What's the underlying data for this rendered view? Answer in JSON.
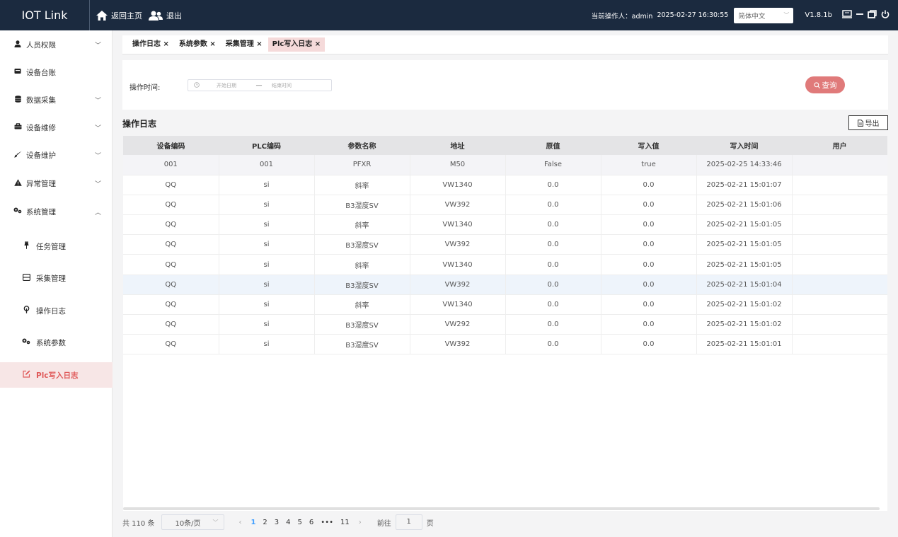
{
  "header": {
    "logo": "IOT Link",
    "home_label": "返回主页",
    "logout_label": "退出",
    "operator": "当前操作人：admin",
    "datetime": "2025-02-27 16:30:55",
    "language": "简体中文",
    "version": "V1.8.1b",
    "bg_color": "#1b2a3f"
  },
  "sidebar": {
    "items": [
      {
        "label": "人员权限",
        "icon": "user-icon"
      },
      {
        "label": "设备台账",
        "icon": "device-icon"
      },
      {
        "label": "数据采集",
        "icon": "database-icon"
      },
      {
        "label": "设备维修",
        "icon": "toolbox-icon"
      },
      {
        "label": "设备维护",
        "icon": "brush-icon"
      },
      {
        "label": "异常管理",
        "icon": "warning-icon"
      },
      {
        "label": "系统管理",
        "icon": "gears-icon"
      }
    ],
    "sub_items": [
      {
        "label": "任务管理",
        "icon": "pin-icon"
      },
      {
        "label": "采集管理",
        "icon": "collect-icon"
      },
      {
        "label": "操作日志",
        "icon": "log-icon"
      },
      {
        "label": "系统参数",
        "icon": "gears-icon"
      },
      {
        "label": "Plc写入日志",
        "icon": "edit-icon"
      }
    ],
    "active_color": "#e05b5b"
  },
  "tabs": [
    {
      "label": "操作日志 ×"
    },
    {
      "label": "系统参数 ×"
    },
    {
      "label": "采集管理 ×"
    },
    {
      "label": "Plc写入日志 ×"
    }
  ],
  "filter": {
    "label": "操作时间:",
    "start_placeholder": "开始日期",
    "separator": "—",
    "end_placeholder": "结束时间",
    "query_label": "查询",
    "query_color": "#e07a7a"
  },
  "section": {
    "title": "操作日志",
    "export_label": "导出"
  },
  "table": {
    "columns": [
      "设备编码",
      "PLC编码",
      "参数名称",
      "地址",
      "原值",
      "写入值",
      "写入时间",
      "用户"
    ],
    "rows": [
      [
        "001",
        "001",
        "PFXR",
        "M50",
        "False",
        "true",
        "2025-02-25 14:33:46",
        ""
      ],
      [
        "QQ",
        "si",
        "斜率",
        "VW1340",
        "0.0",
        "0.0",
        "2025-02-21 15:01:07",
        ""
      ],
      [
        "QQ",
        "si",
        "B3湿度SV",
        "VW392",
        "0.0",
        "0.0",
        "2025-02-21 15:01:06",
        ""
      ],
      [
        "QQ",
        "si",
        "斜率",
        "VW1340",
        "0.0",
        "0.0",
        "2025-02-21 15:01:05",
        ""
      ],
      [
        "QQ",
        "si",
        "B3湿度SV",
        "VW392",
        "0.0",
        "0.0",
        "2025-02-21 15:01:05",
        ""
      ],
      [
        "QQ",
        "si",
        "斜率",
        "VW1340",
        "0.0",
        "0.0",
        "2025-02-21 15:01:05",
        ""
      ],
      [
        "QQ",
        "si",
        "B3湿度SV",
        "VW392",
        "0.0",
        "0.0",
        "2025-02-21 15:01:04",
        ""
      ],
      [
        "QQ",
        "si",
        "斜率",
        "VW1340",
        "0.0",
        "0.0",
        "2025-02-21 15:01:02",
        ""
      ],
      [
        "QQ",
        "si",
        "B3湿度SV",
        "VW292",
        "0.0",
        "0.0",
        "2025-02-21 15:01:02",
        ""
      ],
      [
        "QQ",
        "si",
        "B3湿度SV",
        "VW392",
        "0.0",
        "0.0",
        "2025-02-21 15:01:01",
        ""
      ]
    ]
  },
  "pagination": {
    "total": "共 110 条",
    "page_size": "10条/页",
    "pages": [
      "1",
      "2",
      "3",
      "4",
      "5",
      "6",
      "•••",
      "11"
    ],
    "current": "1",
    "goto_label": "前往",
    "goto_value": "1",
    "goto_suffix": "页",
    "prev": "‹",
    "next": "›"
  }
}
